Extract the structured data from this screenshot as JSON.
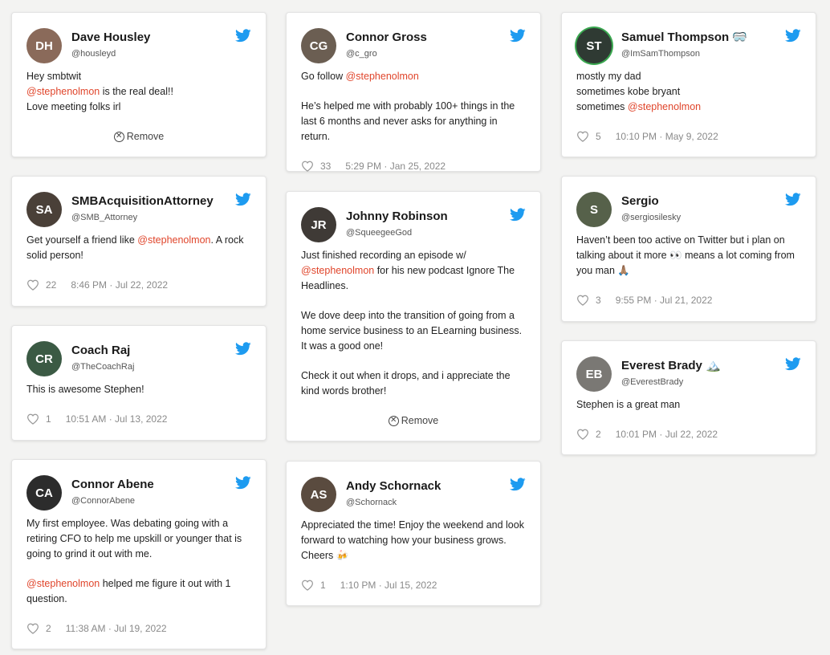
{
  "cards": [
    {
      "name": "Dave Housley",
      "handle": "@housleyd",
      "remove_label": "Remove",
      "avatar_color": "#8a6a5a",
      "lines": [
        "Hey smbtwit",
        "@stephenolmon",
        " is the real deal!!",
        "Love meeting folks irl"
      ]
    },
    {
      "name": "SMBAcquisitionAttorney",
      "handle": "@SMB_Attorney",
      "likes": "22",
      "time": "8:46 PM · Jul 22, 2022",
      "avatar_color": "#4a4038",
      "lines": [
        "Get yourself a friend like ",
        "@stephenolmon",
        ". A rock solid person!"
      ]
    },
    {
      "name": "Coach Raj",
      "handle": "@TheCoachRaj",
      "likes": "1",
      "time": "10:51 AM · Jul 13, 2022",
      "avatar_color": "#3b5a44",
      "lines": [
        "This is awesome Stephen!"
      ]
    },
    {
      "name": "Connor Abene",
      "handle": "@ConnorAbene",
      "likes": "2",
      "time": "11:38 AM · Jul 19, 2022",
      "avatar_color": "#2c2c2c",
      "lines": [
        "My first employee. Was debating going with a retiring CFO to help me upskill or younger that is going to grind it out with me.",
        "@stephenolmon",
        " helped me figure it out with 1 question."
      ]
    },
    {
      "name": "Connor Gross",
      "handle": "@c_gro",
      "likes": "33",
      "time": "5:29 PM · Jan 25, 2022",
      "avatar_color": "#6b5e52",
      "lines": [
        "Go follow ",
        "@stephenolmon",
        "He’s helped me with probably 100+ things in the last 6 months and never asks for anything in return."
      ]
    },
    {
      "name": "Johnny Robinson",
      "handle": "@SqueegeeGod",
      "remove_label": "Remove",
      "avatar_color": "#3f3a36",
      "lines": [
        "Just finished recording an episode w/",
        "@stephenolmon",
        " for his new podcast Ignore The Headlines.",
        "We dove deep into the transition of going from a home service business to an ELearning business. It was a good one!",
        "Check it out when it drops, and i appreciate the kind words brother!"
      ]
    },
    {
      "name": "Andy Schornack",
      "handle": "@Schornack",
      "likes": "1",
      "time": "1:10 PM · Jul 15, 2022",
      "avatar_color": "#5a4b3f",
      "lines": [
        "Appreciated the time! Enjoy the weekend and look forward to watching how your business grows. Cheers 🍻"
      ]
    },
    {
      "name": "Samuel Thompson 🥽",
      "handle": "@ImSamThompson",
      "likes": "5",
      "time": "10:10 PM · May 9, 2022",
      "avatar_color": "#2f3a33",
      "lines": [
        "mostly my dad",
        "sometimes kobe bryant",
        "sometimes ",
        "@stephenolmon"
      ]
    },
    {
      "name": "Sergio",
      "handle": "@sergiosilesky",
      "likes": "3",
      "time": "9:55 PM · Jul 21, 2022",
      "avatar_color": "#56614a",
      "lines": [
        "Haven’t been too active on Twitter but i plan on talking about it more 👀 means a lot coming from you man 🙏🏽"
      ]
    },
    {
      "name": "Everest Brady 🏔️",
      "handle": "@EverestBrady",
      "likes": "2",
      "time": "10:01 PM · Jul 22, 2022",
      "avatar_color": "#7a7874",
      "lines": [
        "Stephen is a great man"
      ]
    }
  ],
  "colors": {
    "mention": "#e0452b",
    "twitter_blue": "#1d9bf0",
    "background": "#f3f3f2"
  },
  "icons": {
    "brand": "twitter-bird-icon",
    "like": "heart-icon",
    "remove": "close-circle-icon"
  }
}
